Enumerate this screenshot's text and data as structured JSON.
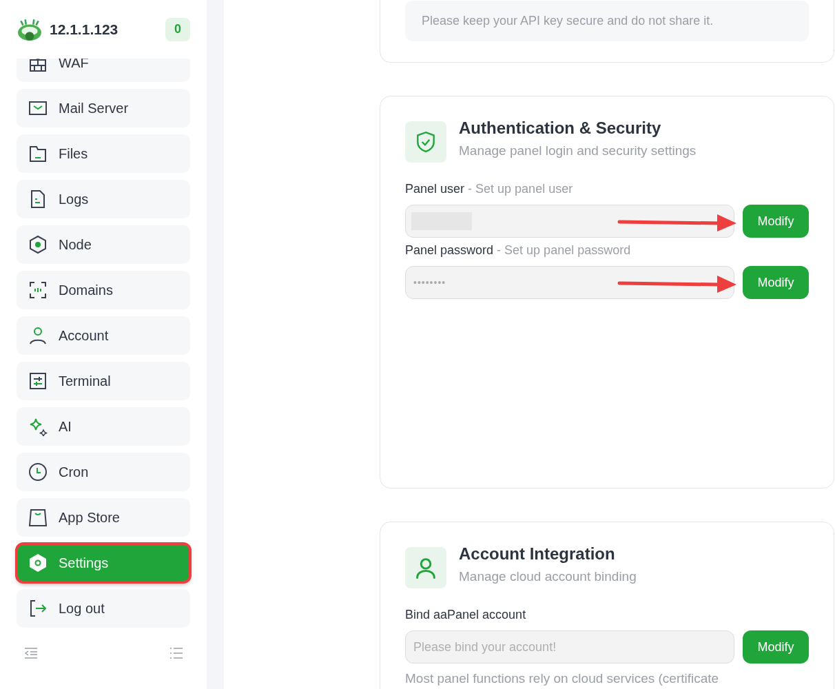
{
  "sidebar": {
    "host": "12.1.1.123",
    "badge": "0",
    "items": [
      {
        "label": "WAF",
        "selected": false,
        "highlighted": false
      },
      {
        "label": "Mail Server",
        "selected": false,
        "highlighted": false
      },
      {
        "label": "Files",
        "selected": false,
        "highlighted": false
      },
      {
        "label": "Logs",
        "selected": false,
        "highlighted": false
      },
      {
        "label": "Node",
        "selected": false,
        "highlighted": false
      },
      {
        "label": "Domains",
        "selected": false,
        "highlighted": false
      },
      {
        "label": "Account",
        "selected": false,
        "highlighted": false
      },
      {
        "label": "Terminal",
        "selected": false,
        "highlighted": false
      },
      {
        "label": "AI",
        "selected": false,
        "highlighted": false
      },
      {
        "label": "Cron",
        "selected": false,
        "highlighted": false
      },
      {
        "label": "App Store",
        "selected": false,
        "highlighted": false
      },
      {
        "label": "Settings",
        "selected": true,
        "highlighted": true
      },
      {
        "label": "Log out",
        "selected": false,
        "highlighted": false
      }
    ]
  },
  "api_card": {
    "note": "Please keep your API key secure and do not share it."
  },
  "cards": [
    {
      "kind": "security",
      "title": "Authentication & Security",
      "subtitle": "Manage panel login and security settings",
      "fields": [
        {
          "label": "Panel user",
          "hint": "- Set up panel user",
          "kind": "redacted",
          "button": "Modify",
          "annotated": true
        },
        {
          "label": "Panel password",
          "hint": "- Set up panel password",
          "kind": "password",
          "value": "••••••••",
          "button": "Modify",
          "annotated": true
        }
      ]
    },
    {
      "kind": "account",
      "title": "Account Integration",
      "subtitle": "Manage cloud account binding",
      "fields": [
        {
          "label": "Bind aaPanel account",
          "kind": "empty",
          "placeholder": "Please bind your account!",
          "button": "Modify",
          "annotated": false
        }
      ],
      "note": "Most panel functions rely on cloud services (certificate"
    }
  ]
}
